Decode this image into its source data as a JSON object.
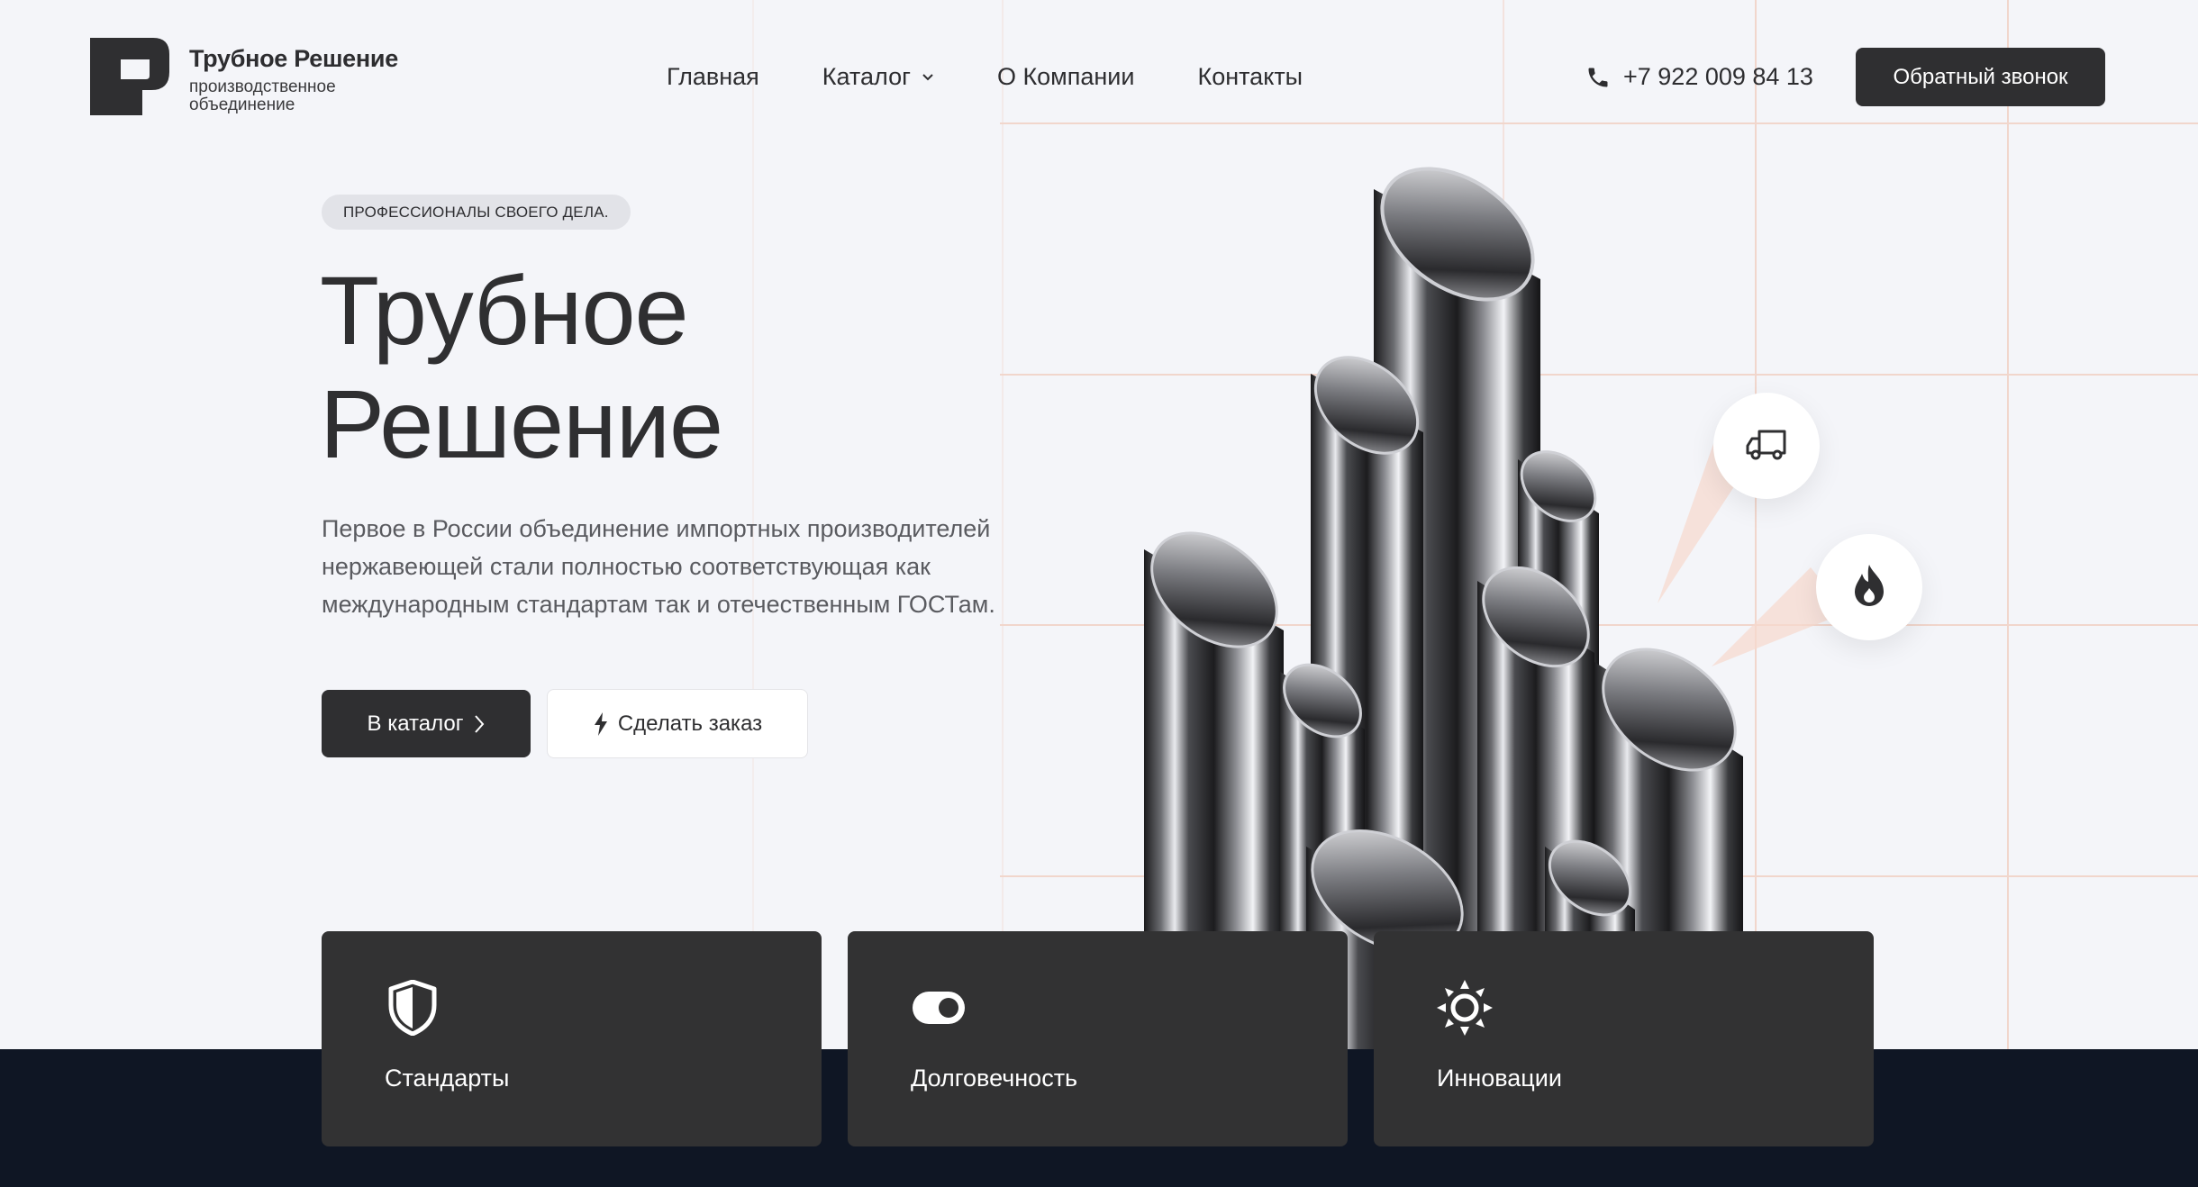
{
  "header": {
    "logo_title": "Трубное Решение",
    "logo_subtitle": "производственное объединение",
    "nav": [
      {
        "label": "Главная"
      },
      {
        "label": "Каталог",
        "has_dropdown": true
      },
      {
        "label": "О Компании"
      },
      {
        "label": "Контакты"
      }
    ],
    "phone": "+7 922 009 84 13",
    "callback_label": "Обратный звонок"
  },
  "hero": {
    "badge": "ПРОФЕССИОНАЛЫ СВОЕГО ДЕЛА.",
    "title_line1": "Трубное",
    "title_line2": "Решение",
    "description": "Первое в России объединение импортных производителей нержавеющей стали полностью соответствующая как международным стандартам так и отечественным ГОСТам.",
    "btn_catalog": "В каталог",
    "btn_order": "Сделать заказ"
  },
  "floating_icons": [
    "truck-icon",
    "flame-icon"
  ],
  "features": [
    {
      "label": "Стандарты",
      "icon": "shield-icon"
    },
    {
      "label": "Долговечность",
      "icon": "toggle-icon"
    },
    {
      "label": "Инновации",
      "icon": "sun-icon"
    }
  ],
  "colors": {
    "background": "#f4f5f9",
    "dark": "#2f2f31",
    "card": "#323233",
    "footer_band": "#0f1624",
    "grid_line": "#f1d6cc"
  }
}
